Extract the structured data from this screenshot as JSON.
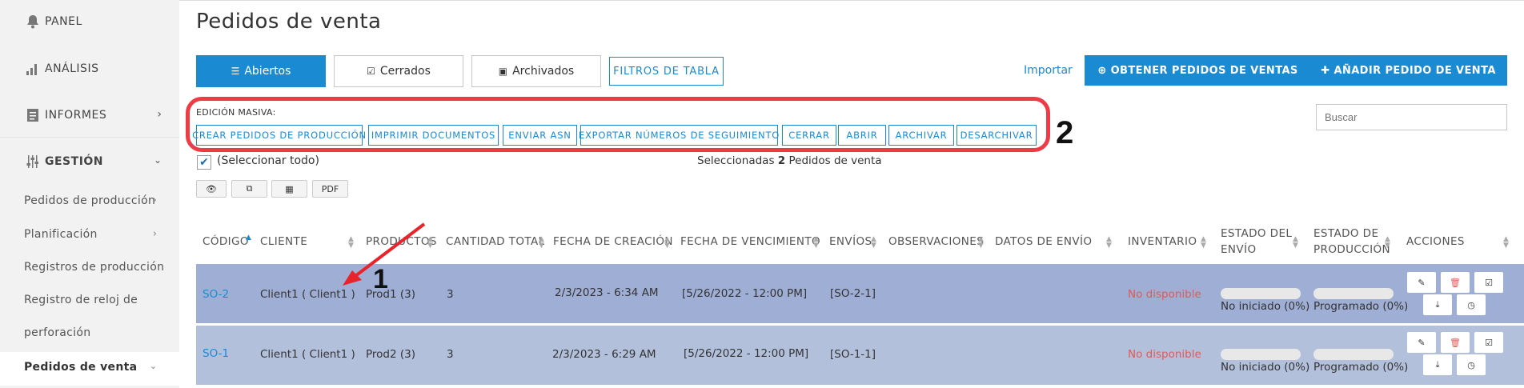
{
  "sidebar": {
    "items": [
      {
        "label": "PANEL",
        "icon": "bell-icon"
      },
      {
        "label": "ANÁLISIS",
        "icon": "bar-chart-icon"
      },
      {
        "label": "INFORMES",
        "icon": "document-icon"
      },
      {
        "label": "GESTIÓN",
        "icon": "sliders-icon"
      }
    ],
    "sub_items": [
      {
        "label": "Pedidos de producción"
      },
      {
        "label": "Planificación"
      },
      {
        "label": "Registros de producción"
      },
      {
        "label": "Registro de reloj de"
      },
      {
        "label": "perforación"
      },
      {
        "label": "Pedidos de venta"
      }
    ]
  },
  "page": {
    "title": "Pedidos de venta"
  },
  "tabs": [
    {
      "label": "Abiertos",
      "icon": "list-icon",
      "active": true
    },
    {
      "label": "Cerrados",
      "icon": "check-square-icon",
      "active": false
    },
    {
      "label": "Archivados",
      "icon": "inbox-icon",
      "active": false
    }
  ],
  "toolbar": {
    "table_filters": "FILTROS DE TABLA",
    "import": "Importar",
    "get_orders": "OBTENER PEDIDOS DE VENTAS",
    "add_order": "AÑADIR PEDIDO DE VENTA"
  },
  "mass_edit": {
    "label": "EDICIÓN MASIVA:",
    "buttons": [
      "CREAR PEDIDOS DE PRODUCCIÓN",
      "IMPRIMIR DOCUMENTOS",
      "ENVIAR ASN",
      "EXPORTAR NÚMEROS DE SEGUIMIENTO",
      "CERRAR",
      "ABRIR",
      "ARCHIVAR",
      "DESARCHIVAR"
    ]
  },
  "search": {
    "placeholder": "Buscar"
  },
  "selection": {
    "select_all": "(Seleccionar todo)",
    "prefix": "Seleccionadas",
    "count": "2",
    "suffix": "Pedidos de venta"
  },
  "view_buttons": {
    "pdf": "PDF"
  },
  "annotations": {
    "one": "1",
    "two": "2"
  },
  "table": {
    "headers": [
      "CÓDIGO",
      "CLIENTE",
      "PRODUCTOS",
      "CANTIDAD TOTAL",
      "FECHA DE CREACIÓN",
      "FECHA DE VENCIMIENTO",
      "ENVÍOS",
      "OBSERVACIONES",
      "DATOS DE ENVÍO",
      "INVENTARIO",
      "ESTADO DEL",
      "ENVÍO",
      "ESTADO DE",
      "PRODUCCIÓN",
      "ACCIONES"
    ],
    "rows": [
      {
        "code": "SO-2",
        "client": "Client1 ( Client1 )",
        "products": "Prod1 (3)",
        "qty": "3",
        "created": "2/3/2023 - 6:34 AM",
        "due": "[5/26/2022 - 12:00 PM]",
        "shipments": "[SO-2-1]",
        "inventory": "No disponible",
        "ship_status": "No iniciado (0%)",
        "prod_status": "Programado (0%)",
        "ship_progress": 0,
        "prod_progress": 0
      },
      {
        "code": "SO-1",
        "client": "Client1 ( Client1 )",
        "products": "Prod2 (3)",
        "qty": "3",
        "created": "2/3/2023 - 6:29 AM",
        "due": "[5/26/2022 - 12:00 PM]",
        "shipments": "[SO-1-1]",
        "inventory": "No disponible",
        "ship_status": "No iniciado (0%)",
        "prod_status": "Programado (0%)",
        "ship_progress": 0,
        "prod_progress": 0
      }
    ]
  },
  "colors": {
    "accent": "#1a8bd3",
    "highlight": "#ee3b45",
    "row1": "#9faed4",
    "row2": "#b3c0dc",
    "danger": "#e05a5a"
  }
}
